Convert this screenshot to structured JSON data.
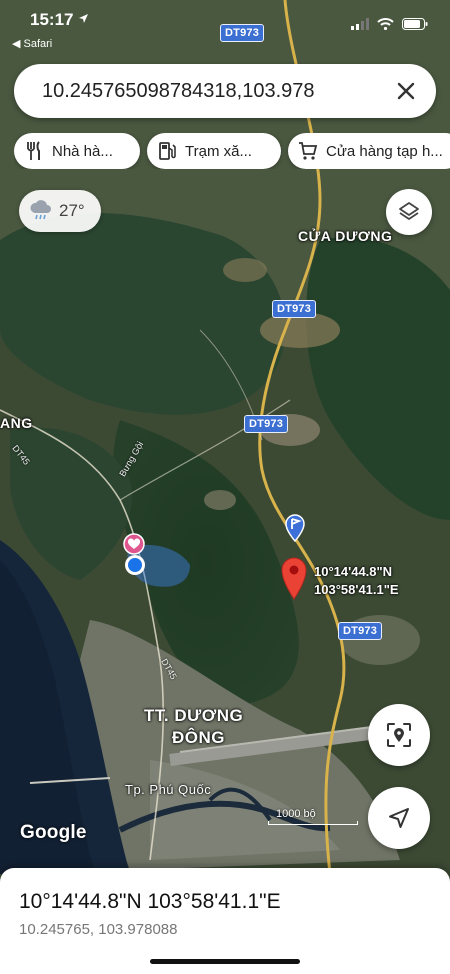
{
  "status_bar": {
    "time": "15:17",
    "back_app": "Safari"
  },
  "search": {
    "value": "10.245765098784318,103.978"
  },
  "chips": [
    {
      "label": "Nhà hà...",
      "icon": "restaurant-icon"
    },
    {
      "label": "Trạm xă...",
      "icon": "gas-station-icon"
    },
    {
      "label": "Cửa hàng tạp h...",
      "icon": "shopping-cart-icon"
    }
  ],
  "weather": {
    "temp": "27°",
    "icon": "rain-cloud-icon"
  },
  "map": {
    "road_shields": [
      "DT973",
      "DT973",
      "DT973",
      "DT973"
    ],
    "places": {
      "cua_duong": "CỬA DƯƠNG",
      "duong_dong_line1": "TT. DƯƠNG",
      "duong_dong_line2": "ĐÔNG",
      "phu_quoc": "Tp. Phú Quốc",
      "ang": "ANG"
    },
    "small_roads": [
      "DT45",
      "Bưng Gội",
      "DT45"
    ],
    "pin_coords": {
      "lat": "10°14'44.8\"N",
      "lon": "103°58'41.1\"E"
    },
    "scale_label": "1000 bộ",
    "attribution": "Google"
  },
  "sheet": {
    "title": "10°14'44.8\"N 103°58'41.1\"E",
    "subtitle": "10.245765, 103.978088"
  },
  "colors": {
    "accent_blue": "#1a73e8",
    "pin_red": "#ea4335",
    "shield_blue": "#3b6fd1"
  }
}
